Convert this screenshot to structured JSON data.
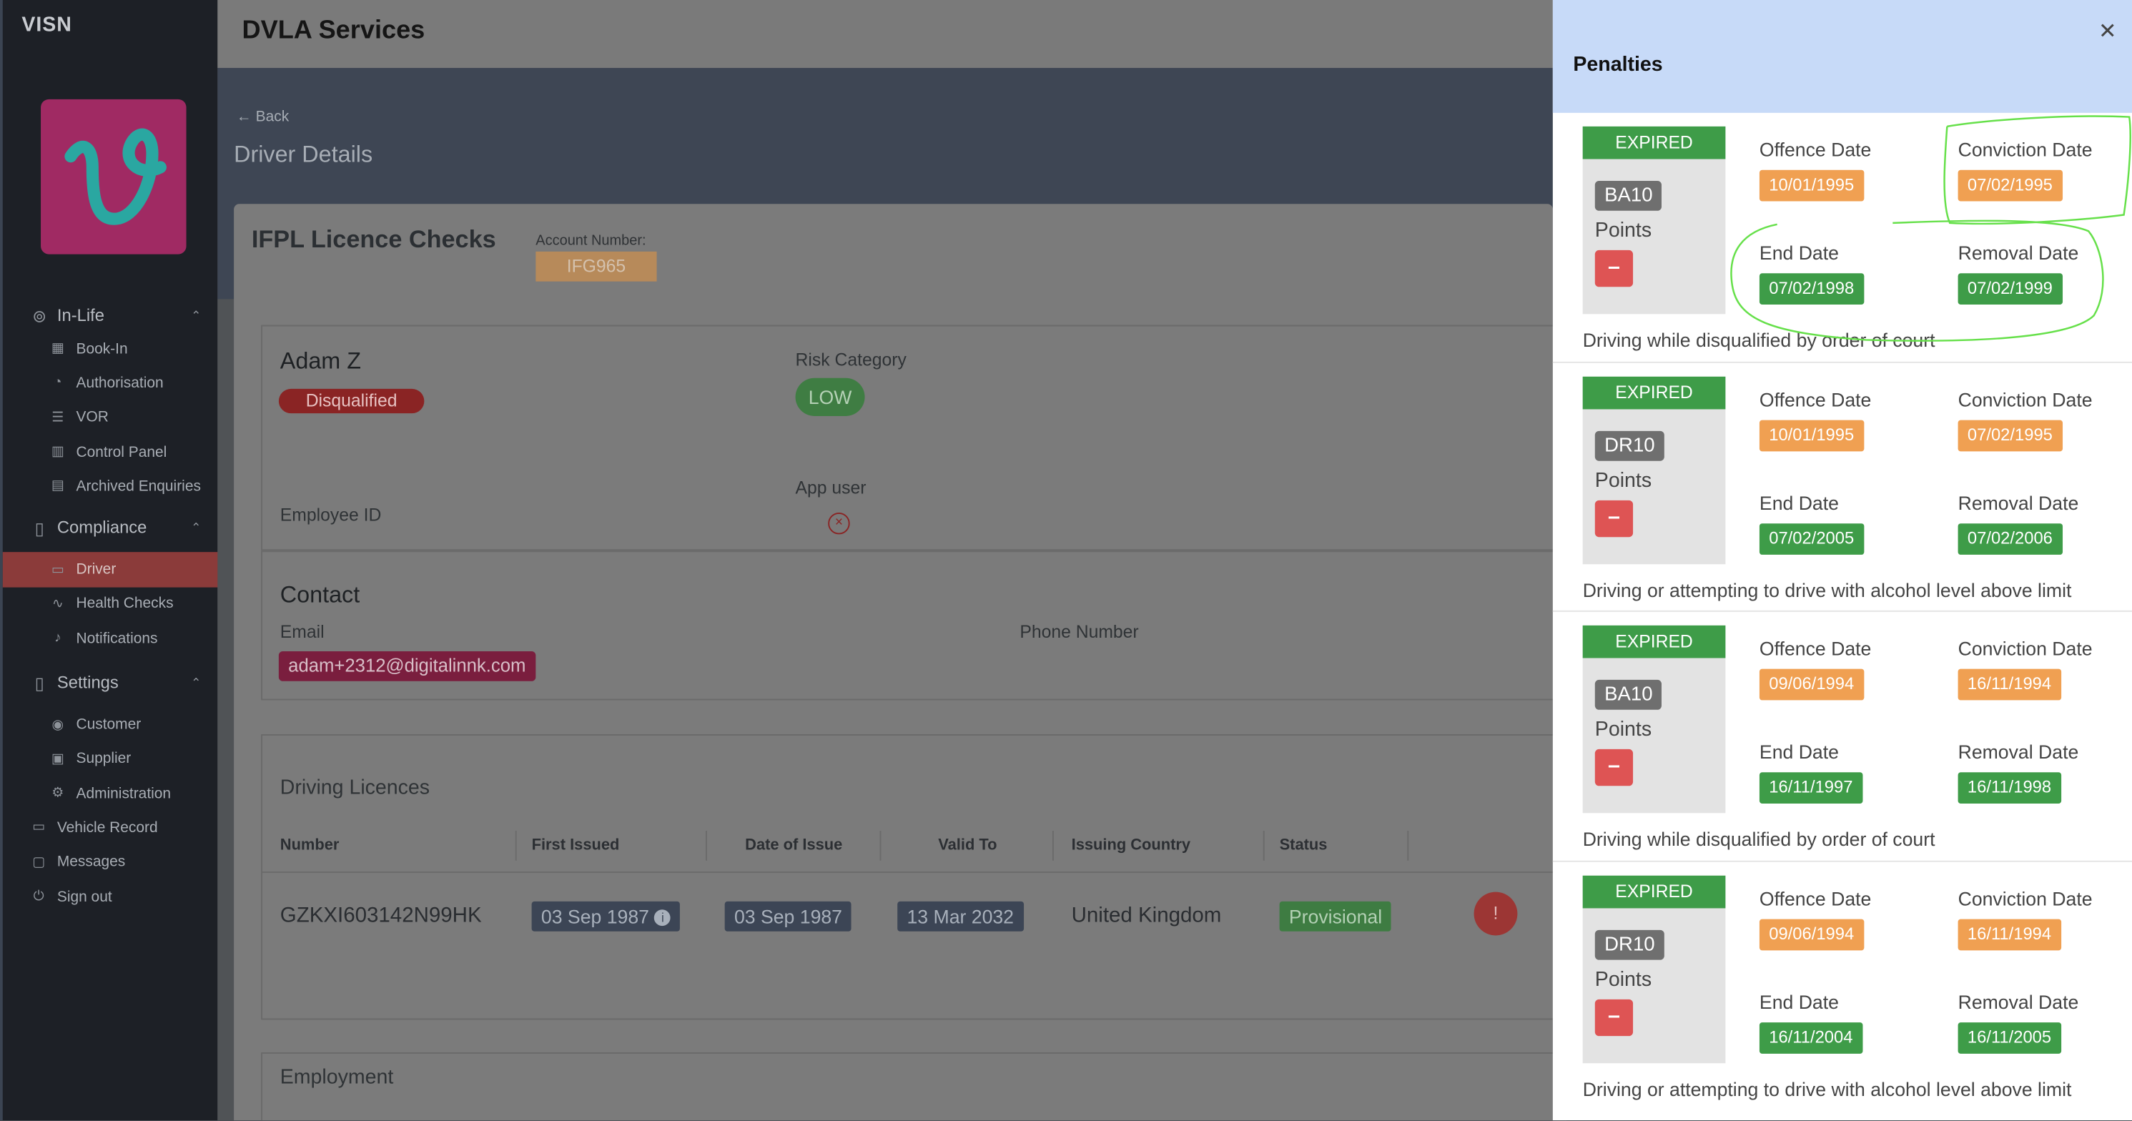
{
  "app": {
    "brand": "VISN",
    "title": "DVLA Services"
  },
  "sidebar": {
    "sections": [
      {
        "label": "In-Life",
        "icon": "lifebuoy-icon",
        "items": [
          {
            "label": "Book-In",
            "icon": "calendar-icon"
          },
          {
            "label": "Authorisation",
            "icon": "clock-icon"
          },
          {
            "label": "VOR",
            "icon": "list-icon"
          },
          {
            "label": "Control Panel",
            "icon": "panel-icon"
          },
          {
            "label": "Archived Enquiries",
            "icon": "archive-icon"
          }
        ]
      },
      {
        "label": "Compliance",
        "icon": "document-icon",
        "items": [
          {
            "label": "Driver",
            "icon": "id-card-icon",
            "active": true
          },
          {
            "label": "Health Checks",
            "icon": "pulse-icon"
          },
          {
            "label": "Notifications",
            "icon": "bell-icon"
          }
        ]
      },
      {
        "label": "Settings",
        "icon": "settings-doc-icon",
        "items": [
          {
            "label": "Customer",
            "icon": "user-circle-icon"
          },
          {
            "label": "Supplier",
            "icon": "briefcase-icon"
          },
          {
            "label": "Administration",
            "icon": "gear-icon"
          }
        ]
      }
    ],
    "bottom": [
      {
        "label": "Vehicle Record",
        "icon": "car-icon"
      },
      {
        "label": "Messages",
        "icon": "chat-icon"
      },
      {
        "label": "Sign out",
        "icon": "power-icon"
      }
    ]
  },
  "page": {
    "back": "← Back",
    "title": "Driver Details"
  },
  "checks": {
    "title": "IFPL Licence Checks",
    "account_label": "Account Number:",
    "account_value": "IFG965"
  },
  "driver": {
    "name": "Adam Z",
    "status": "Disqualified",
    "risk_label": "Risk Category",
    "risk_value": "LOW",
    "employee_label": "Employee ID",
    "app_user_label": "App user"
  },
  "contact": {
    "title": "Contact",
    "email_label": "Email",
    "email_value": "adam+2312@digitalinnk.com",
    "phone_label": "Phone Number"
  },
  "licences": {
    "title": "Driving Licences",
    "columns": [
      "Number",
      "First Issued",
      "Date of Issue",
      "Valid To",
      "Issuing Country",
      "Status"
    ],
    "row": {
      "number": "GZKXI603142N99HK",
      "first_issued": "03 Sep 1987",
      "date_of_issue": "03 Sep 1987",
      "valid_to": "13 Mar 2032",
      "country": "United Kingdom",
      "status": "Provisional"
    }
  },
  "employment": {
    "title": "Employment"
  },
  "penalties": {
    "title": "Penalties",
    "labels": {
      "offence_date": "Offence Date",
      "conviction_date": "Conviction Date",
      "end_date": "End Date",
      "removal_date": "Removal Date",
      "points": "Points",
      "minus": "–"
    },
    "items": [
      {
        "status": "EXPIRED",
        "code": "BA10",
        "offence_date": "10/01/1995",
        "conviction_date": "07/02/1995",
        "end_date": "07/02/1998",
        "removal_date": "07/02/1999",
        "description": "Driving while disqualified by order of court"
      },
      {
        "status": "EXPIRED",
        "code": "DR10",
        "offence_date": "10/01/1995",
        "conviction_date": "07/02/1995",
        "end_date": "07/02/2005",
        "removal_date": "07/02/2006",
        "description": "Driving or attempting to drive with alcohol level above limit"
      },
      {
        "status": "EXPIRED",
        "code": "BA10",
        "offence_date": "09/06/1994",
        "conviction_date": "16/11/1994",
        "end_date": "16/11/1997",
        "removal_date": "16/11/1998",
        "description": "Driving while disqualified by order of court"
      },
      {
        "status": "EXPIRED",
        "code": "DR10",
        "offence_date": "09/06/1994",
        "conviction_date": "16/11/1994",
        "end_date": "16/11/2004",
        "removal_date": "16/11/2005",
        "description": "Driving or attempting to drive with alcohol level above limit"
      }
    ]
  },
  "colors": {
    "expired": "#3e9c48",
    "date_orange": "#f0a052",
    "date_green": "#3e9c48",
    "annotation": "#66e04a"
  }
}
